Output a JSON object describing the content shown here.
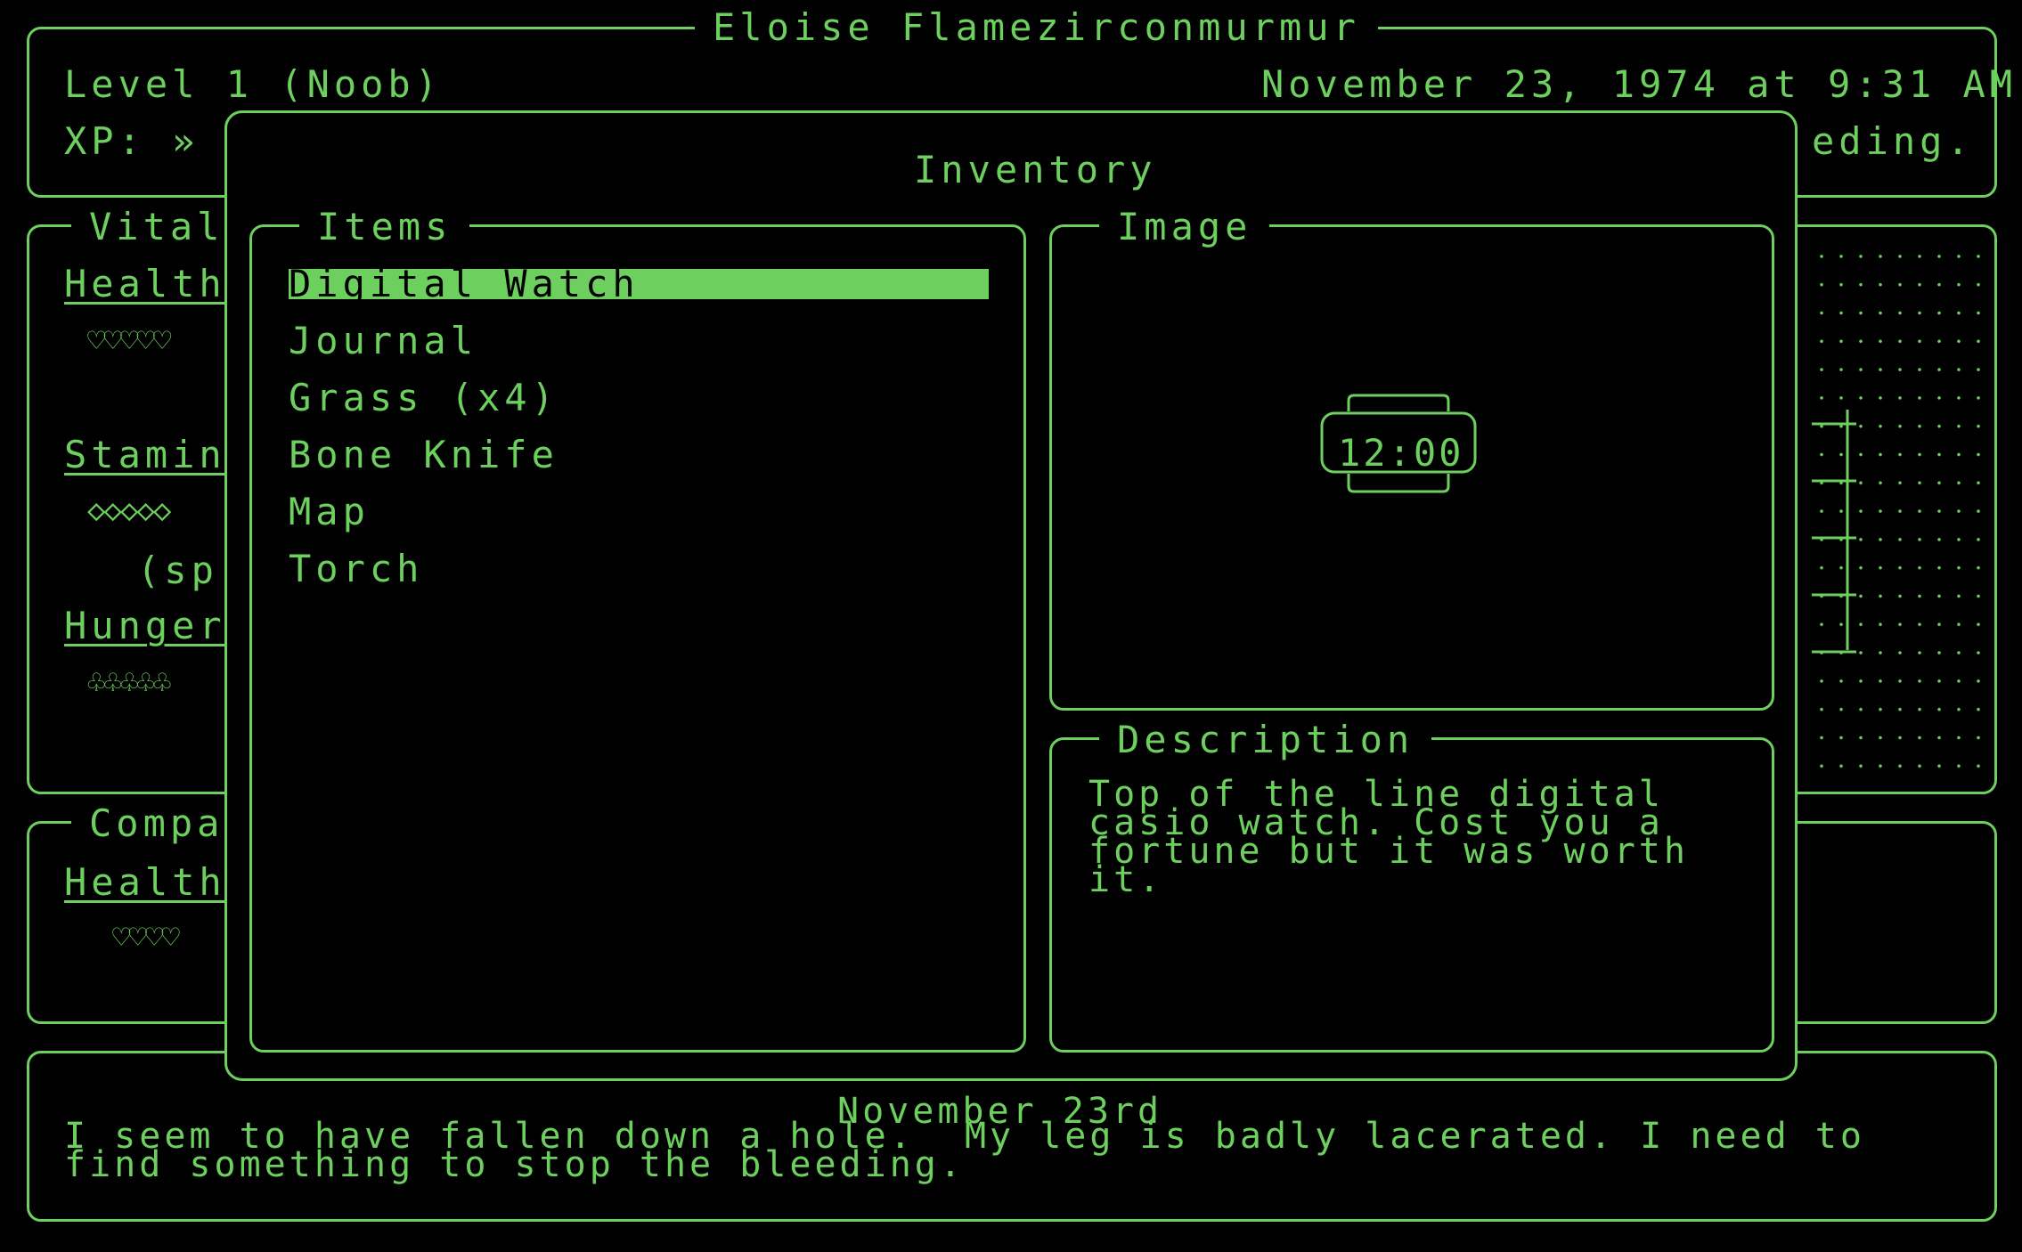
{
  "header": {
    "player_name": "Eloise Flamezirconmurmur",
    "level": "Level 1 (Noob)",
    "datetime": "November 23, 1974 at 9:31 AM",
    "xp_label": "XP: »",
    "status_fragment": "eding."
  },
  "vitals": {
    "title": "Vital",
    "health_label": "Health",
    "health_hearts": "♡♡♡♡♡",
    "stamina_label": "Stamin",
    "stamina_diamonds": "◇◇◇◇◇",
    "stamina_note": "(sp",
    "hunger_label": "Hunger",
    "hunger_icons": "♧♧♧♧♧"
  },
  "companion": {
    "title": "Compa",
    "health_label": "Health",
    "health_hearts": "♡♡♡♡"
  },
  "inventory": {
    "title": "Inventory",
    "items_title": "Items",
    "items": [
      {
        "label": "Digital Watch",
        "selected": true
      },
      {
        "label": "Journal",
        "selected": false
      },
      {
        "label": "Grass (x4)",
        "selected": false
      },
      {
        "label": "Bone Knife",
        "selected": false
      },
      {
        "label": "Map",
        "selected": false
      },
      {
        "label": "Torch",
        "selected": false
      }
    ],
    "image_title": "Image",
    "watch_display": "12:00",
    "description_title": "Description",
    "description_text": "Top of the line digital casio watch. Cost you a fortune but it was worth it."
  },
  "journal": {
    "date": "November 23rd",
    "line1": "I seem to have fallen down a hole.  My leg is badly lacerated. I need to",
    "line2": "find something to stop the bleeding."
  },
  "colors": {
    "phosphor": "#6ccf5e",
    "background": "#000000"
  }
}
